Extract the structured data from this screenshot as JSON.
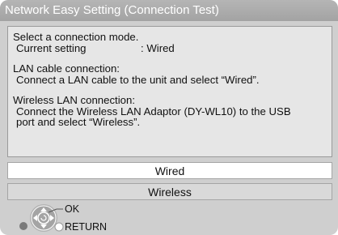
{
  "window": {
    "title": "Network Easy Setting (Connection Test)"
  },
  "info": {
    "prompt": "Select a connection mode.",
    "current_setting_label": "Current setting",
    "current_setting_value": ":  Wired",
    "lan_heading": "LAN cable connection:",
    "lan_text": "Connect a LAN cable to the unit and select “Wired”.",
    "wireless_heading": "Wireless LAN connection:",
    "wireless_text_1": "Connect the Wireless LAN Adaptor (DY-WL10) to the USB",
    "wireless_text_2": "port and select “Wireless”."
  },
  "options": [
    {
      "label": "Wired",
      "selected": true
    },
    {
      "label": "Wireless",
      "selected": false
    }
  ],
  "legend": {
    "ok_label": "OK",
    "return_label": "RETURN",
    "icons": [
      "dpad-icon",
      "ok-button-icon",
      "return-button-icon"
    ]
  },
  "colors": {
    "background": "#cfcfcf",
    "title_bar": "#ababab",
    "panel": "#e6e6e6",
    "selected_option": "#ffffff",
    "return_dot": "#ffffff",
    "side_dot": "#7a7a7a"
  }
}
